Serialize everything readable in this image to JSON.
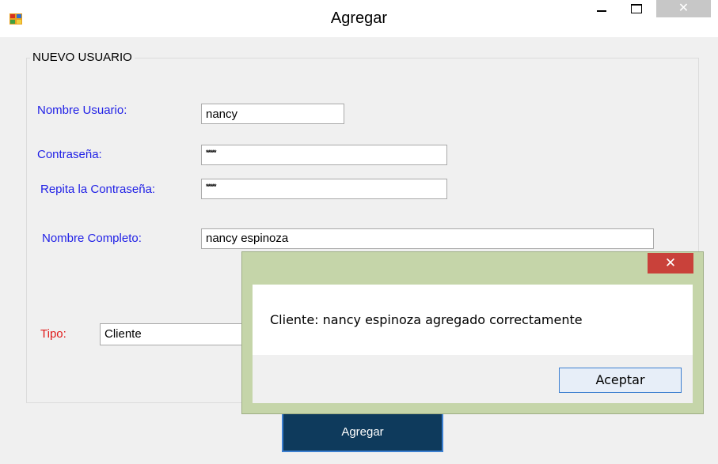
{
  "window": {
    "title": "Agregar",
    "close_glyph": "✕"
  },
  "form": {
    "group_title": "NUEVO USUARIO",
    "username_label": "Nombre Usuario:",
    "username_value": "nancy",
    "password_label": "Contraseña:",
    "password_value": "*****",
    "repeat_label": "Repita la Contraseña:",
    "repeat_value": "*****",
    "fullname_label": "Nombre Completo:",
    "fullname_value": "nancy espinoza",
    "type_label": "Tipo:",
    "type_value": "Cliente",
    "submit_label": "Agregar"
  },
  "dialog": {
    "close_glyph": "✕",
    "message": "Cliente: nancy espinoza agregado correctamente",
    "ok_label": "Aceptar"
  },
  "colors": {
    "label_blue": "#1f1fe6",
    "label_red": "#e01818",
    "submit_bg": "#0e3a5c",
    "dialog_frame": "#c5d5a9",
    "dialog_close_red": "#c9413a"
  }
}
